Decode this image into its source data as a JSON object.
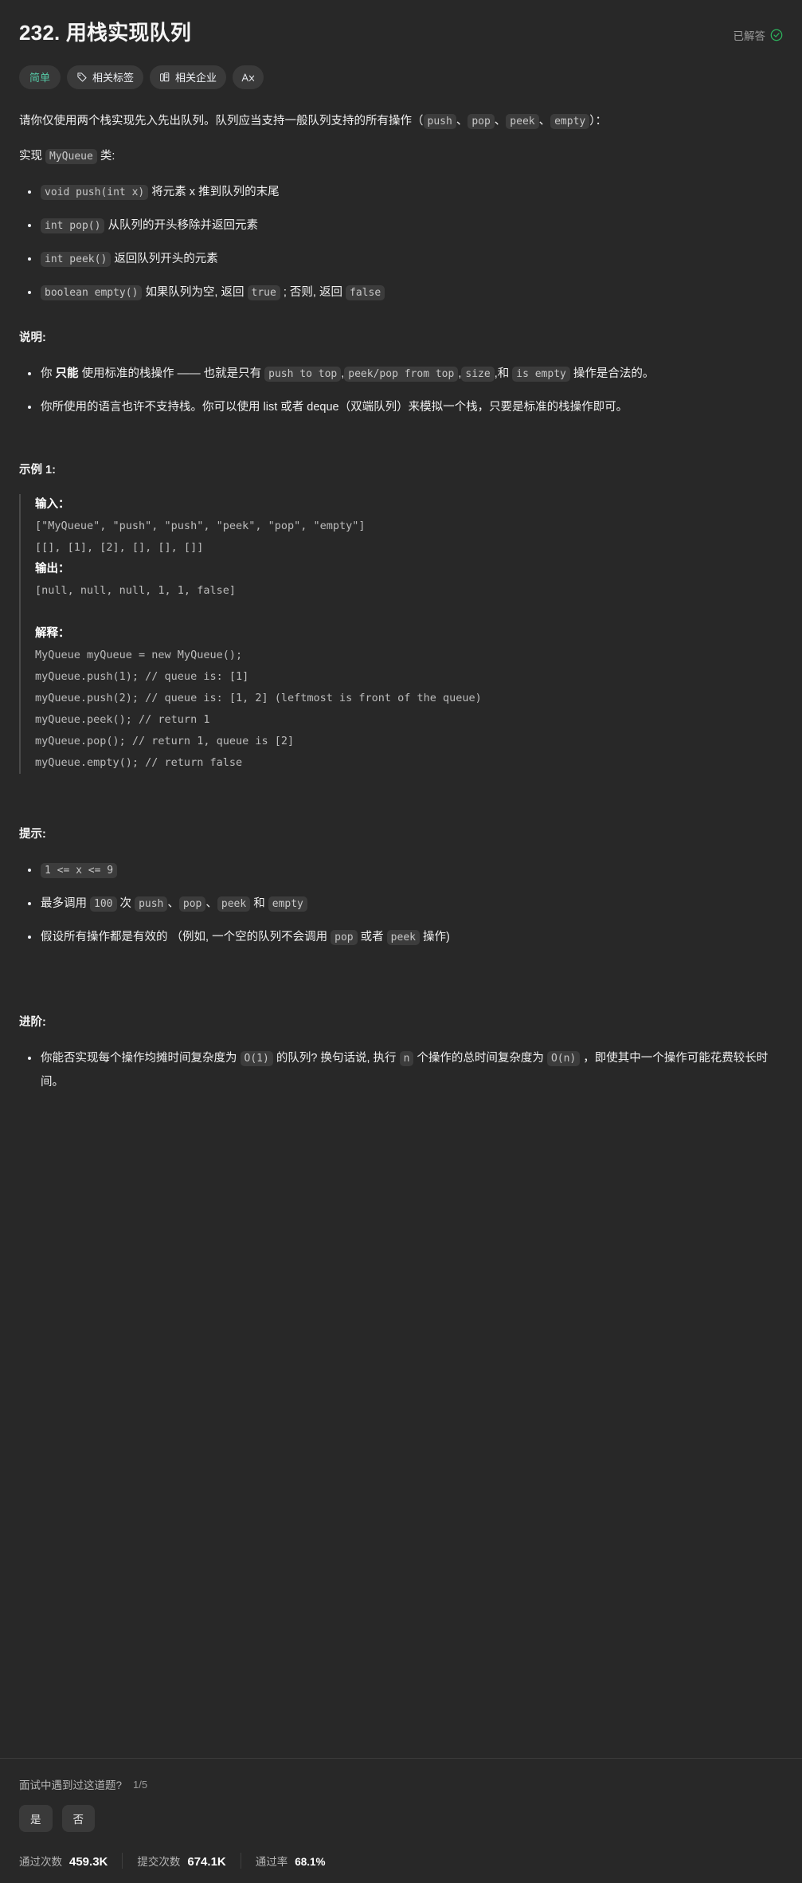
{
  "header": {
    "title": "232. 用栈实现队列",
    "status_label": "已解答",
    "status_icon": "check-circle-icon",
    "status_color": "#2db55d"
  },
  "pills": [
    {
      "id": "difficulty",
      "label": "简单",
      "icon": null,
      "color": "#55c7a5"
    },
    {
      "id": "related-tags",
      "label": "相关标签",
      "icon": "tag-icon"
    },
    {
      "id": "related-companies",
      "label": "相关企业",
      "icon": "building-icon"
    },
    {
      "id": "translate",
      "label": "",
      "icon": "translate-icon"
    }
  ],
  "description": {
    "intro_p1": "请你仅使用两个栈实现先入先出队列。队列应当支持一般队列支持的所有操作（",
    "intro_code_push": "push",
    "intro_sep1": "、",
    "intro_code_pop": "pop",
    "intro_sep2": "、",
    "intro_code_peek": "peek",
    "intro_sep3": "、",
    "intro_code_empty": "empty",
    "intro_p1_end": "）：",
    "impl_prefix": "实现",
    "impl_code": "MyQueue",
    "impl_suffix": "类:",
    "methods": [
      {
        "code": "void push(int x)",
        "text": "将元素 x 推到队列的末尾"
      },
      {
        "code": "int pop()",
        "text": "从队列的开头移除并返回元素"
      },
      {
        "code": "int peek()",
        "text": "返回队列开头的元素"
      }
    ],
    "method_empty": {
      "code": "boolean empty()",
      "text_a": "如果队列为空, 返回",
      "code_true": "true",
      "text_b": "; 否则, 返回",
      "code_false": "false"
    }
  },
  "notes": {
    "heading": "说明:",
    "bullet1": {
      "a": "你",
      "strong": "只能",
      "b": "使用标准的栈操作 —— 也就是只有",
      "c1": "push to top",
      "sep1": ",",
      "c2": "peek/pop from top",
      "sep2": ",",
      "c3": "size",
      "sep3": ",和",
      "c4": "is empty",
      "d": "操作是合法的。"
    },
    "bullet2": "你所使用的语言也许不支持栈。你可以使用 list 或者 deque（双端队列）来模拟一个栈，只要是标准的栈操作即可。"
  },
  "example": {
    "title": "示例 1:",
    "input_label": "输入：",
    "input_line1": "[\"MyQueue\", \"push\", \"push\", \"peek\", \"pop\", \"empty\"]",
    "input_line2": "[[], [1], [2], [], [], []]",
    "output_label": "输出：",
    "output_line": "[null, null, null, 1, 1, false]",
    "explain_label": "解释：",
    "explain_lines": [
      "MyQueue myQueue = new MyQueue();",
      "myQueue.push(1); // queue is: [1]",
      "myQueue.push(2); // queue is: [1, 2] (leftmost is front of the queue)",
      "myQueue.peek(); // return 1",
      "myQueue.pop(); // return 1, queue is [2]",
      "myQueue.empty(); // return false"
    ]
  },
  "hints": {
    "heading": "提示:",
    "b1_code": "1 <= x <= 9",
    "b2": {
      "a": "最多调用",
      "c1": "100",
      "b": "次",
      "c2": "push",
      "s1": "、",
      "c3": "pop",
      "s2": "、",
      "c4": "peek",
      "c": "和",
      "c5": "empty"
    },
    "b3": {
      "a": "假设所有操作都是有效的 （例如, 一个空的队列不会调用",
      "c1": "pop",
      "b": "或者",
      "c2": "peek",
      "c": "操作)"
    }
  },
  "followup": {
    "heading": "进阶:",
    "b1": {
      "a": "你能否实现每个操作均摊时间复杂度为",
      "c1": "O(1)",
      "b": "的队列? 换句话说, 执行",
      "c2": "n",
      "c": "个操作的总时间复杂度为",
      "c3": "O(n)",
      "d": "，即使其中一个操作可能花费较长时间。"
    }
  },
  "footer": {
    "ask_question": "面试中遇到过这道题?",
    "ask_count": "1/5",
    "yes_label": "是",
    "no_label": "否",
    "stats": [
      {
        "label": "通过次数",
        "value": "459.3K",
        "bold": true
      },
      {
        "label": "提交次数",
        "value": "674.1K",
        "bold": true
      },
      {
        "label": "通过率",
        "value": "68.1%",
        "bold": false
      }
    ]
  }
}
